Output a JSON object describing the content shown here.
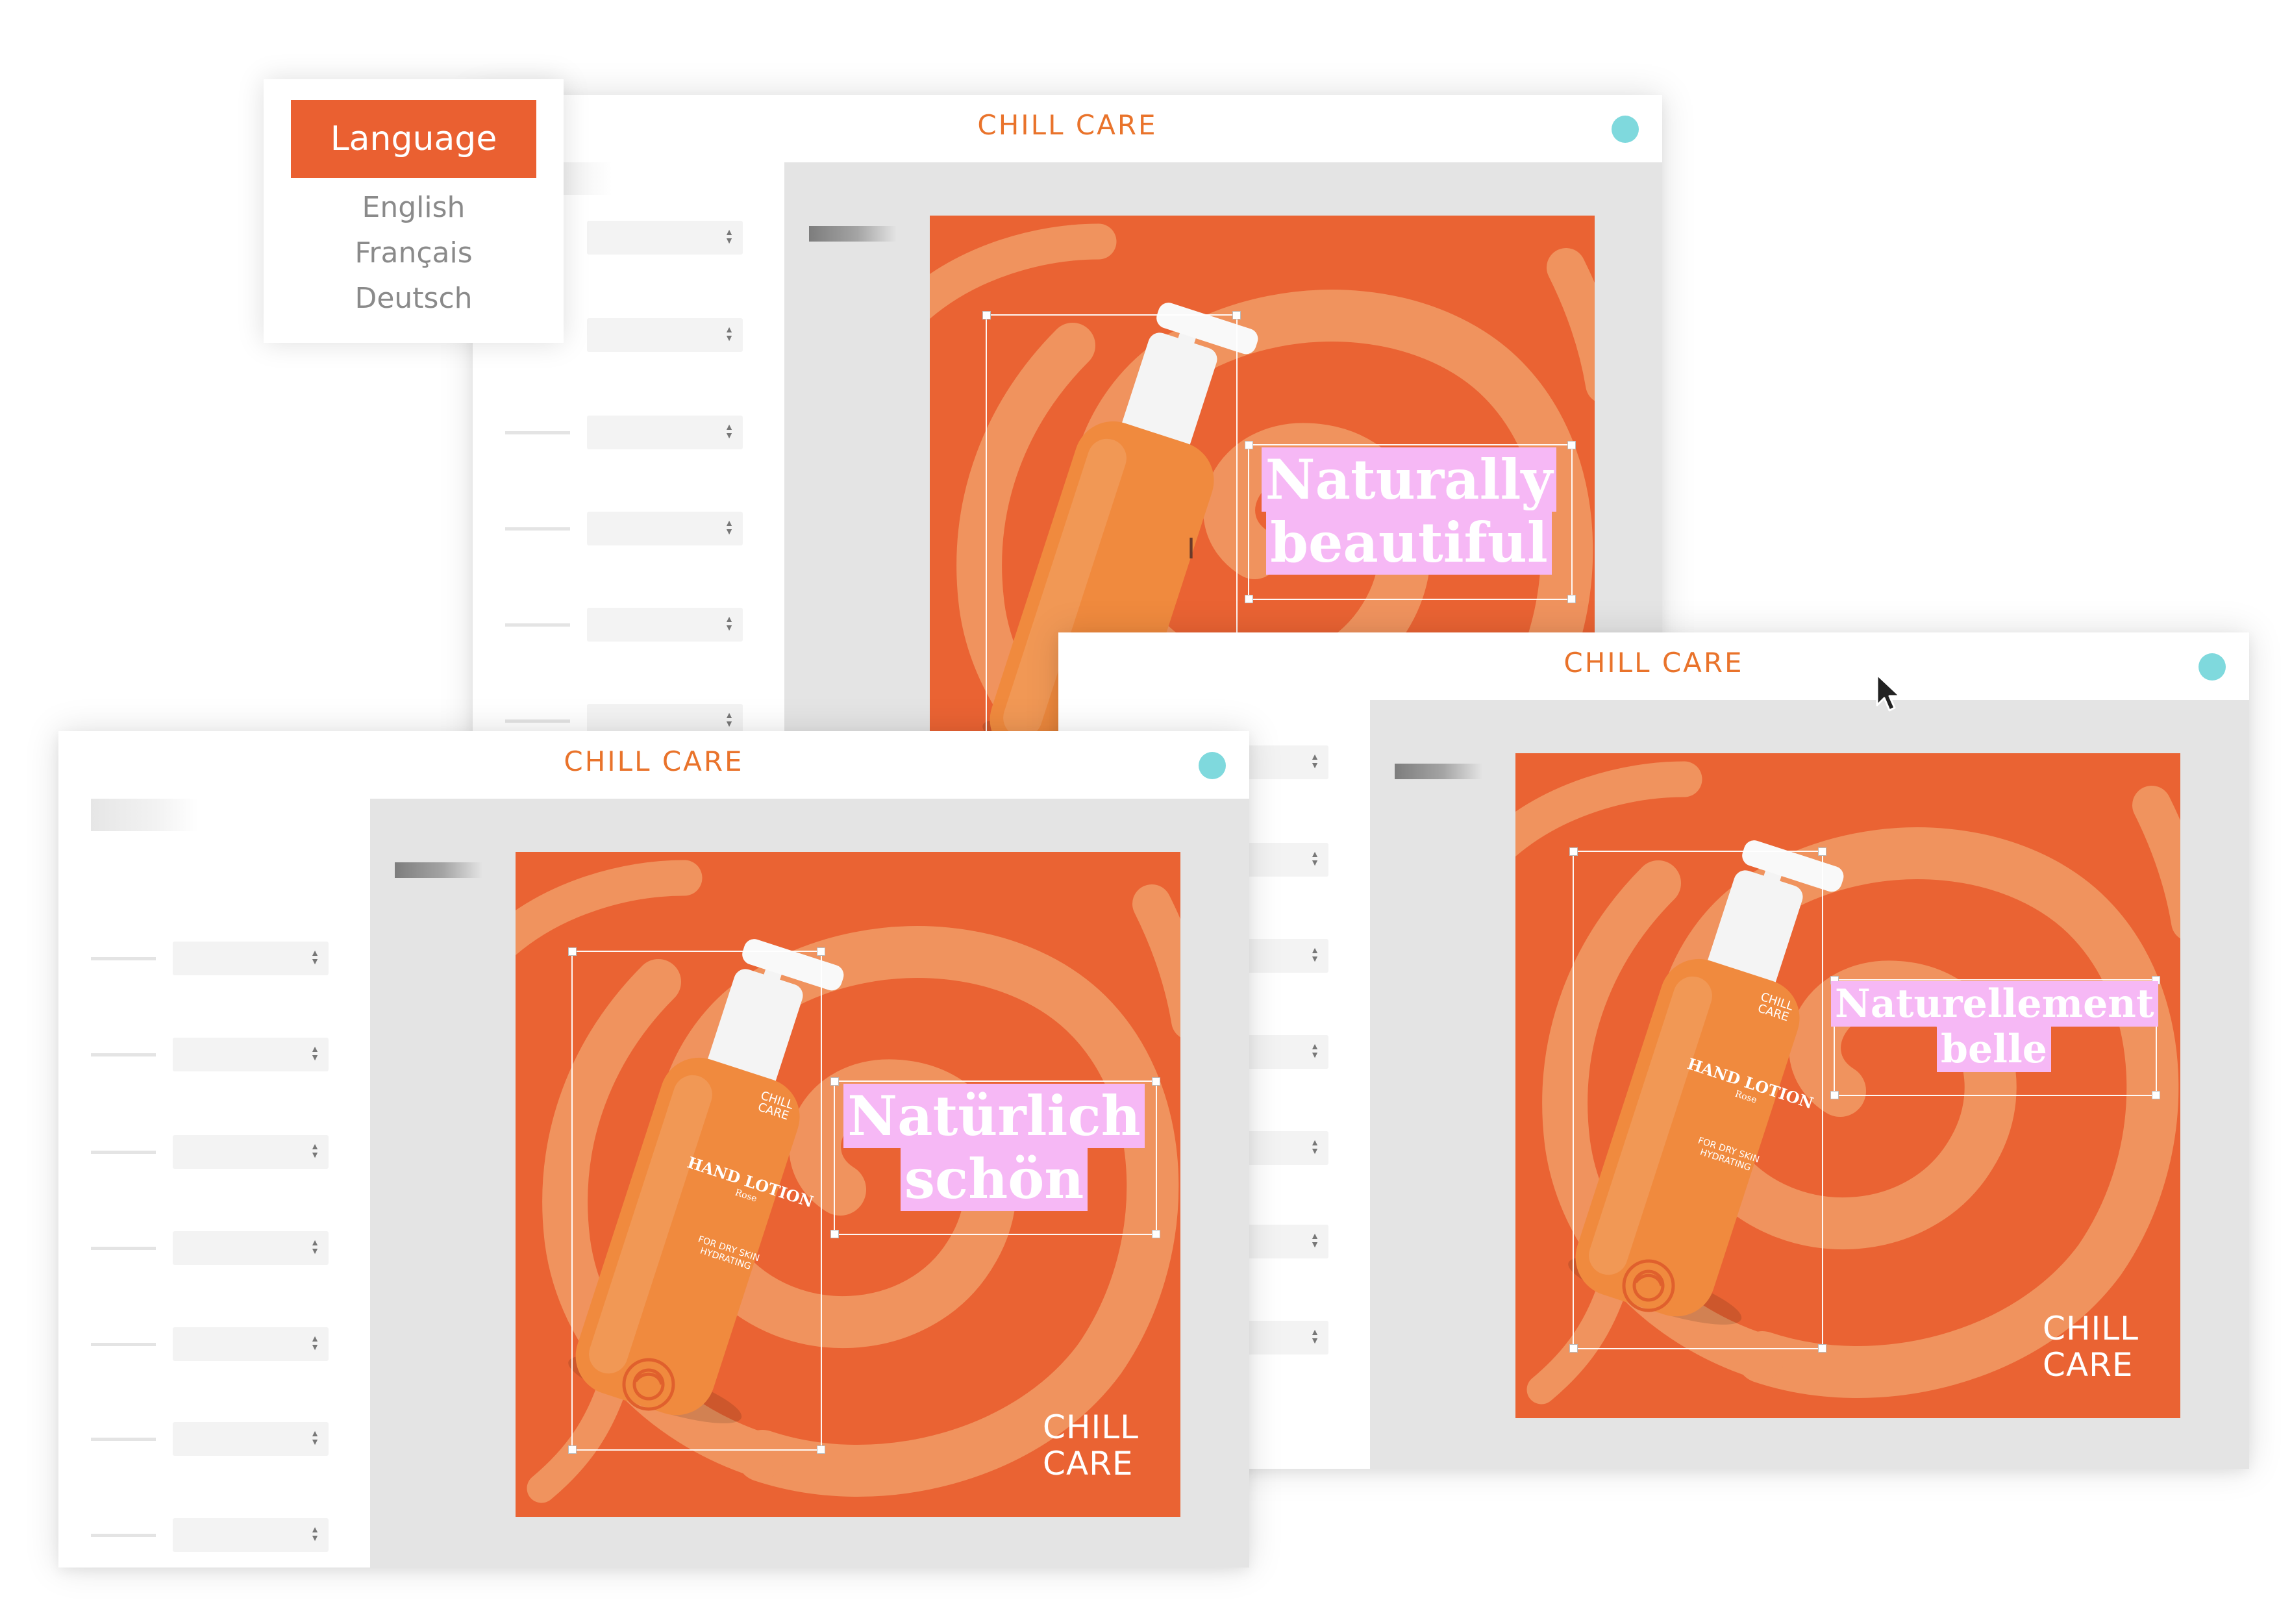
{
  "colors": {
    "brand": "#e9732b",
    "brand_button": "#ea6031",
    "status_dot": "#7fd9dd",
    "art_background": "#ea6333",
    "swirl": "#f0935e",
    "headline_highlight": "#f6b8f5",
    "bottle": "#f08a3e"
  },
  "language_menu": {
    "button_label": "Language",
    "options": [
      "English",
      "Français",
      "Deutsch"
    ]
  },
  "windows": {
    "english": {
      "title": "CHILL  CARE",
      "headline_line1": "Naturally",
      "headline_line2": "beautiful"
    },
    "german": {
      "title": "CHILL  CARE",
      "headline_line1": "Natürlich",
      "headline_line2": "schön"
    },
    "french": {
      "title": "CHILL  CARE",
      "headline_line1": "Naturellement",
      "headline_line2": "belle"
    }
  },
  "art": {
    "brand_line1": "CHILL",
    "brand_line2": "CARE",
    "bottle_logo_line1": "CHILL",
    "bottle_logo_line2": "CARE",
    "bottle_product": "HAND LOTION",
    "bottle_variant": "Rose",
    "bottle_desc_line1": "FOR DRY SKIN",
    "bottle_desc_line2": "HYDRATING"
  },
  "icons": {
    "status": "circle-icon",
    "select_arrows": "updown-arrows-icon",
    "text_cursor": "text-cursor-icon",
    "pointer": "mouse-pointer-icon",
    "rose": "rose-icon"
  }
}
